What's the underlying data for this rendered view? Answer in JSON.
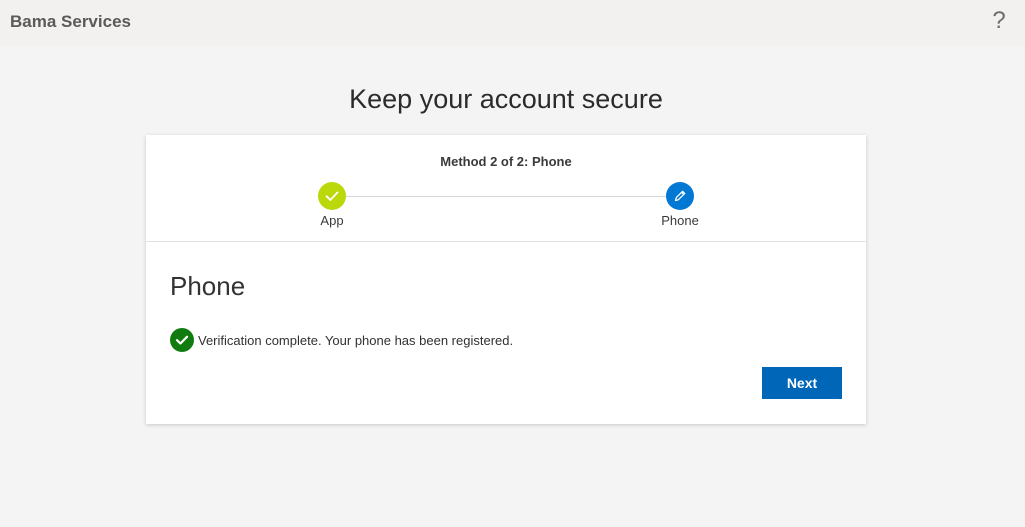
{
  "header": {
    "brand": "Bama Services",
    "help_glyph": "?"
  },
  "page_title": "Keep your account secure",
  "card": {
    "method_title": "Method 2 of 2: Phone",
    "steps": [
      {
        "label": "App",
        "state": "complete",
        "icon": "check-icon",
        "color": "#bad80a"
      },
      {
        "label": "Phone",
        "state": "current",
        "icon": "pencil-icon",
        "color": "#0078d4"
      }
    ],
    "section_title": "Phone",
    "status_message": "Verification complete. Your phone has been registered.",
    "status_icon": "check-circle-icon",
    "status_color": "#107c10",
    "next_label": "Next",
    "accent_color": "#0067b8"
  }
}
